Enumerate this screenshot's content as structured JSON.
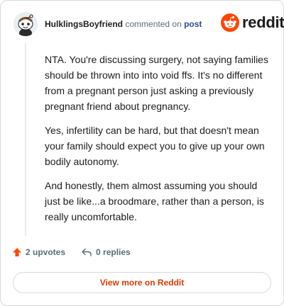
{
  "header": {
    "username": "HulklingsBoyfriend",
    "commented_on": "commented on",
    "post_link": "post",
    "brand_name": "reddit"
  },
  "comment": {
    "paragraphs": [
      "NTA. You're discussing surgery, not saying families should be thrown into into void ffs. It's no different from a pregnant person just asking a previously pregnant friend about pregnancy.",
      "Yes, infertility can be hard, but that doesn't mean your family should expect you to give up your own bodily autonomy.",
      "And honestly, them almost assuming you should just be like...a broodmare, rather than a person, is really uncomfortable."
    ]
  },
  "actions": {
    "upvotes": "2 upvotes",
    "replies": "0 replies"
  },
  "footer": {
    "view_more": "View more on Reddit"
  },
  "colors": {
    "brand": "#ff4500",
    "link": "#2a4c9a",
    "muted": "#576f76",
    "cta": "#d93a00"
  }
}
